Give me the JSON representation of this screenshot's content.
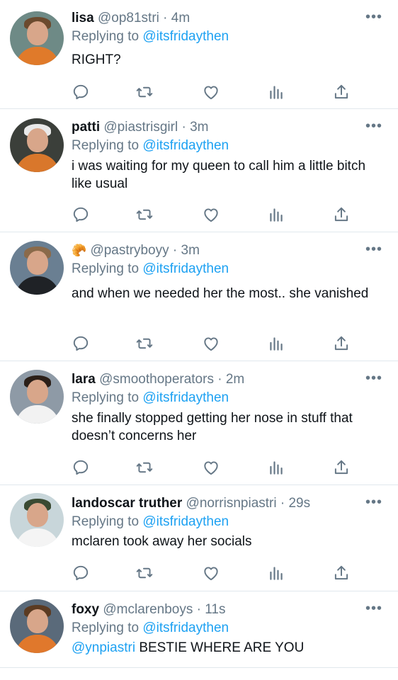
{
  "replying_label": "Replying to",
  "replying_target": "@itsfridaythen",
  "more_label": "•••",
  "tweets": [
    {
      "name": "lisa",
      "handle": "@op81stri",
      "time": "4m",
      "text": "RIGHT?",
      "text_mention": "",
      "avatar_colors": {
        "bg": "#6e8a86",
        "hair": "#6b4a2e",
        "body": "#e07a2a"
      }
    },
    {
      "name": "patti",
      "handle": "@piastrisgirl",
      "time": "3m",
      "text": "i was waiting for my queen to call him a little bitch like usual",
      "text_mention": "",
      "avatar_colors": {
        "bg": "#3b3f3a",
        "hair": "#e9e9e9",
        "body": "#d9772b"
      }
    },
    {
      "name": "🥐",
      "handle": "@pastryboyy",
      "time": "3m",
      "text": "and when we needed her the most.. she vanished",
      "text_mention": "",
      "avatar_colors": {
        "bg": "#6a7f92",
        "hair": "#8a6a4a",
        "body": "#1f2226"
      }
    },
    {
      "name": "lara",
      "handle": "@smoothoperators",
      "time": "2m",
      "text": "she finally stopped getting her nose in stuff that doesn’t concerns her",
      "text_mention": "",
      "avatar_colors": {
        "bg": "#8e9aa6",
        "hair": "#2b1f18",
        "body": "#f2f2f2"
      }
    },
    {
      "name": "landoscar truther",
      "handle": "@norrisnpiastri",
      "time": "29s",
      "text": "mclaren took away her socials",
      "text_mention": "",
      "avatar_colors": {
        "bg": "#c8d6da",
        "hair": "#3a4a32",
        "body": "#f4f4f4"
      }
    },
    {
      "name": "foxy",
      "handle": "@mclarenboys",
      "time": "11s",
      "text": "BESTIE WHERE ARE YOU",
      "text_mention": "@ynpiastri",
      "avatar_colors": {
        "bg": "#5a6a7a",
        "hair": "#5b3b22",
        "body": "#e0782c"
      }
    }
  ]
}
